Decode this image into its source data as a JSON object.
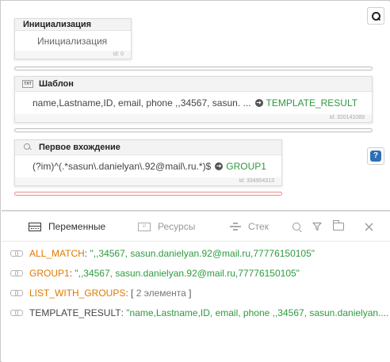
{
  "canvas": {
    "nodes": [
      {
        "title": "Инициализация",
        "body": "Инициализация",
        "id_label": "id: 0"
      },
      {
        "title": "Шаблон",
        "icon_text": "TXT",
        "body": "name,Lastname,ID, email, phone ,,34567, sasun. ...",
        "target": "TEMPLATE_RESULT",
        "id_label": "id: 320141089"
      },
      {
        "title": "Первое вхождение",
        "body": "(?im)^(.*sasun\\.danielyan\\.92@mail\\.ru.*)$",
        "target": "GROUP1",
        "id_label": "id: 334904313"
      }
    ],
    "help_label": "?"
  },
  "panel": {
    "tabs": [
      {
        "label": "Переменные",
        "active": true,
        "icon": "table-icon"
      },
      {
        "label": "Ресурсы",
        "active": false,
        "icon": "resources-icon"
      },
      {
        "label": "Стек",
        "active": false,
        "icon": "stack-icon"
      }
    ],
    "tools": [
      "search-icon",
      "filter-icon",
      "folder-icon",
      "close-icon"
    ],
    "variables": [
      {
        "name": "ALL_MATCH",
        "sep": ": ",
        "value": "\",,34567, sasun.danielyan.92@mail.ru,77776150105\""
      },
      {
        "name": "GROUP1",
        "sep": ": ",
        "value": "\",,34567, sasun.danielyan.92@mail.ru,77776150105\""
      },
      {
        "name": "LIST_WITH_GROUPS",
        "sep": ": ",
        "value_open": "[ ",
        "value": "2 элемента",
        "value_close": " ]"
      },
      {
        "name": "TEMPLATE_RESULT",
        "sep": ": ",
        "value": "\"name,Lastname,ID, email, phone ,,34567, sasun.danielyan...."
      }
    ]
  },
  "colors": {
    "variable_name": "#e07a00",
    "string_value": "#2e9a3e",
    "help_button": "#2f6fb5",
    "error_connector": "#f08a8a"
  }
}
